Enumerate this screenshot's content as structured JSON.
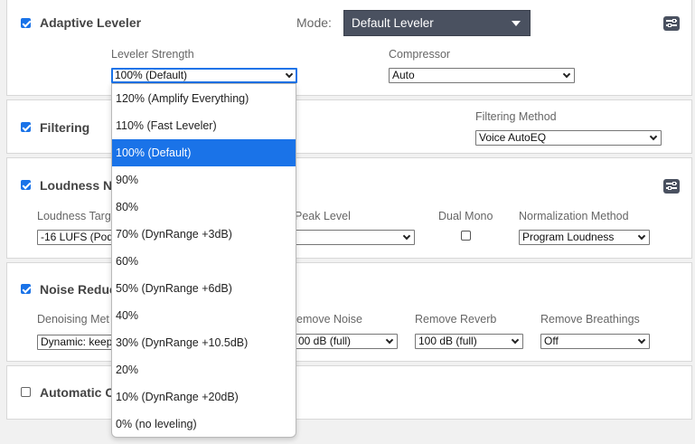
{
  "colors": {
    "accent": "#1a73e8",
    "mode_select_bg": "#4a5160"
  },
  "adaptive_leveler": {
    "title": "Adaptive Leveler",
    "checked": true,
    "mode_label": "Mode:",
    "mode_value": "Default Leveler",
    "leveler_strength_label": "Leveler Strength",
    "leveler_strength_value": "100% (Default)",
    "compressor_label": "Compressor",
    "compressor_value": "Auto",
    "settings_icon": "sliders-icon"
  },
  "filtering": {
    "title": "Filtering",
    "checked": true,
    "method_label": "Filtering Method",
    "method_value": "Voice AutoEQ"
  },
  "loudness": {
    "title": "Loudness N",
    "checked": true,
    "target_label": "Loudness Targ",
    "target_value": "-16 LUFS (Pod",
    "peak_label": "Peak Level",
    "peak_value": "",
    "dual_mono_label": "Dual Mono",
    "dual_mono_checked": false,
    "norm_method_label": "Normalization Method",
    "norm_method_value": "Program Loudness",
    "settings_icon": "sliders-icon"
  },
  "noise_reduction": {
    "title": "Noise Reduc",
    "checked": true,
    "denoising_label": "Denoising Met",
    "denoising_value": "Dynamic: keep",
    "remove_noise_label": "emove Noise",
    "remove_noise_value": "00 dB (full)",
    "remove_reverb_label": "Remove Reverb",
    "remove_reverb_value": "100 dB (full)",
    "remove_breathings_label": "Remove Breathings",
    "remove_breathings_value": "Off"
  },
  "automatic": {
    "title": "Automatic C",
    "checked": false
  },
  "dropdown": {
    "items": [
      "120% (Amplify Everything)",
      "110% (Fast Leveler)",
      "100% (Default)",
      "90%",
      "80%",
      "70% (DynRange +3dB)",
      "60%",
      "50% (DynRange +6dB)",
      "40%",
      "30% (DynRange +10.5dB)",
      "20%",
      "10% (DynRange +20dB)",
      "0% (no leveling)"
    ],
    "selected_index": 2
  }
}
